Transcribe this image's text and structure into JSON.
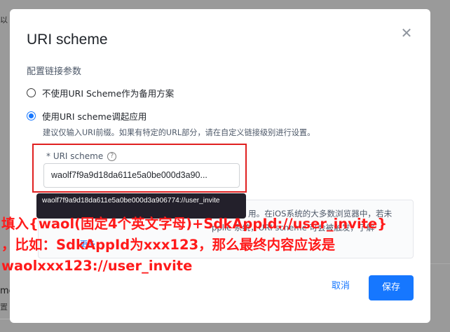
{
  "background": {
    "top_fragment": "以",
    "left_fragment_1": "me",
    "left_fragment_2": "置"
  },
  "modal": {
    "title": "URI scheme",
    "close_icon": "close-icon",
    "section_label": "配置链接参数",
    "options": [
      {
        "label": "不使用URI Scheme作为备用方案",
        "checked": false
      },
      {
        "label": "使用URI scheme调起应用",
        "checked": true
      }
    ],
    "hint": "建议仅输入URI前缀。如果有特定的URL部分，请在自定义链接级别进行设置。",
    "field": {
      "label": "* URI scheme",
      "help_icon": "question-circle-icon",
      "value": "waolf7f9a9d18da611e5a0be000d3a90..."
    },
    "tooltip": "waolf7f9a9d18da611e5a0be000d3a906774://user_invite",
    "info": {
      "line1": "用。在iOS系统的大多数浏览器中，若未",
      "line2": "pplie 系统，URI scheme 可会被触发，了解",
      "link": "更多"
    },
    "cancel_label": "取消",
    "save_label": "保存"
  },
  "annotation": {
    "line1": "填入{waol(固定4个英文字母)+SdkAppId://user_invite}",
    "line2": "，比如：SdkAppId为xxx123，那么最终内容应该是",
    "line3": "waolxxx123://user_invite"
  },
  "colors": {
    "accent": "#1677ff",
    "annotation_red": "#ff1a1a",
    "tooltip_bg": "#23202b",
    "overlay": "#9a9a9a"
  }
}
